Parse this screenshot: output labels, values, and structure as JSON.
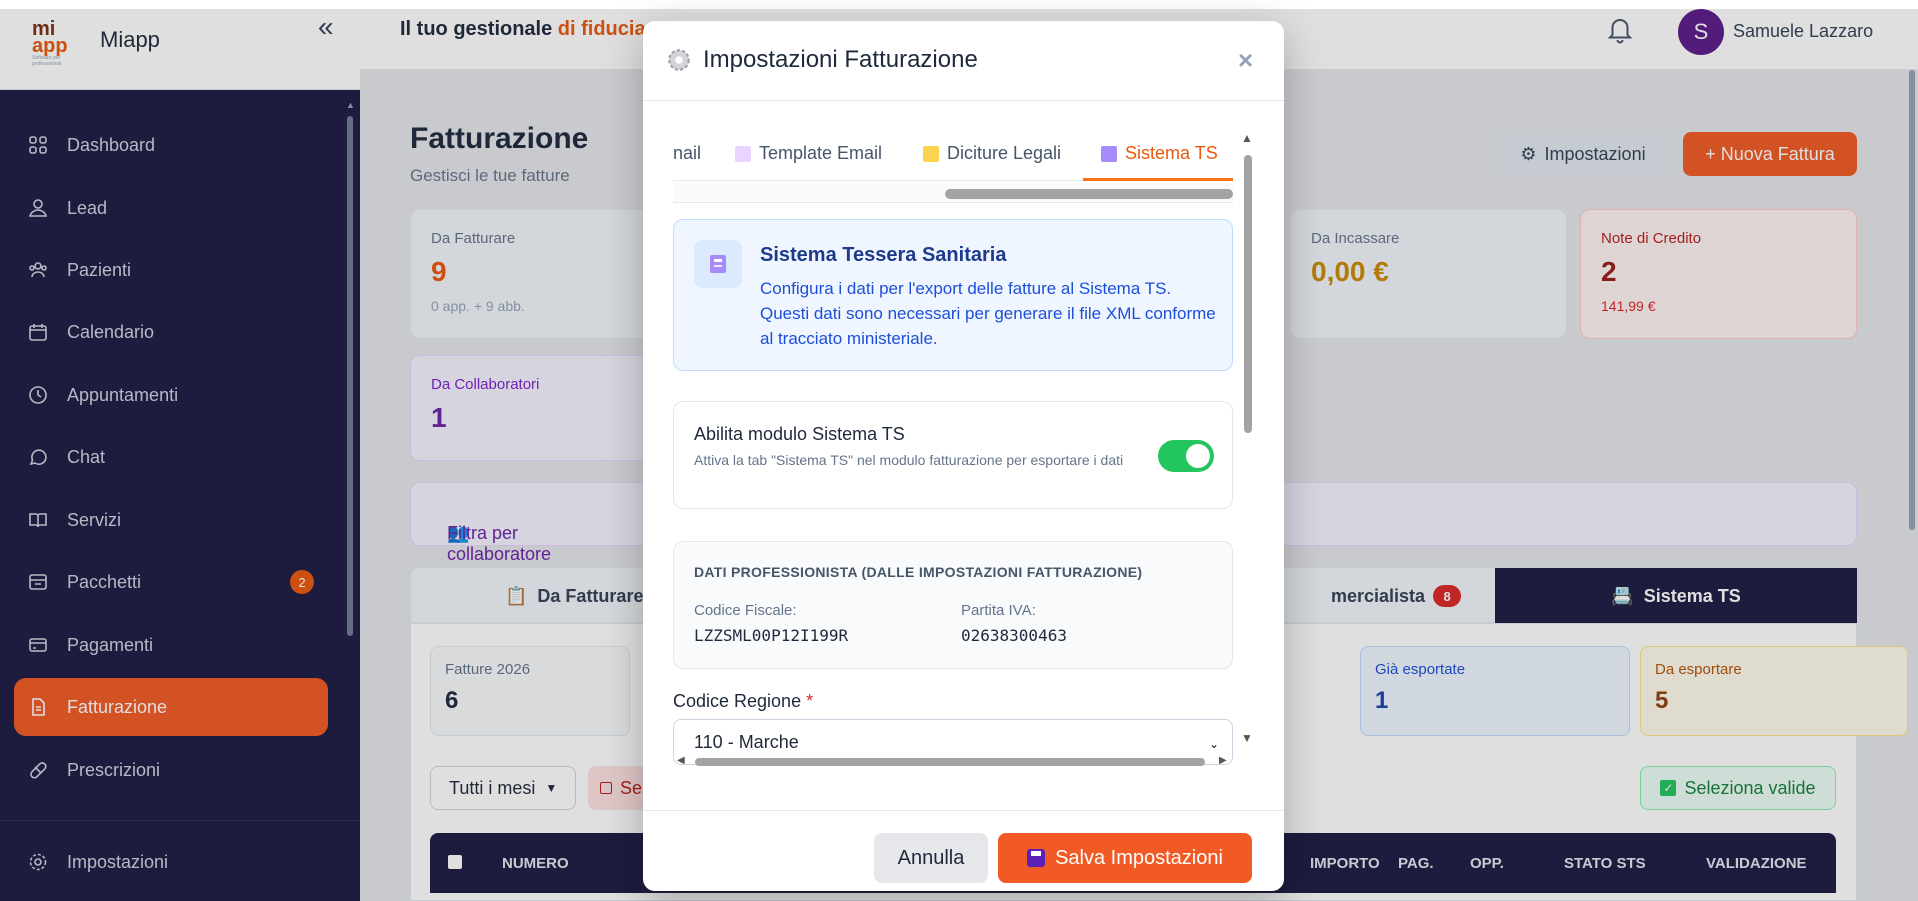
{
  "app": {
    "brand": "Miapp",
    "logo_line1": "mi",
    "logo_line2": "app",
    "logo_tag": "Software per professionisti",
    "tagline_prefix": "Il tuo gestionale ",
    "tagline_accent": "di fiducia"
  },
  "user": {
    "initial": "S",
    "name": "Samuele Lazzaro"
  },
  "sidebar": {
    "items": [
      {
        "label": "Dashboard",
        "icon": "grid-icon"
      },
      {
        "label": "Lead",
        "icon": "user-icon"
      },
      {
        "label": "Pazienti",
        "icon": "users-icon"
      },
      {
        "label": "Calendario",
        "icon": "calendar-icon"
      },
      {
        "label": "Appuntamenti",
        "icon": "clock-icon"
      },
      {
        "label": "Chat",
        "icon": "chat-icon"
      },
      {
        "label": "Servizi",
        "icon": "book-icon"
      },
      {
        "label": "Pacchetti",
        "icon": "package-icon",
        "badge": "2"
      },
      {
        "label": "Pagamenti",
        "icon": "credit-card-icon"
      },
      {
        "label": "Fatturazione",
        "icon": "file-icon",
        "active": true
      },
      {
        "label": "Prescrizioni",
        "icon": "pill-icon"
      }
    ],
    "settings_label": "Impostazioni"
  },
  "page": {
    "title": "Fatturazione",
    "subtitle": "Gestisci le tue fatture",
    "settings_button": "Impostazioni",
    "new_button": "+ Nuova Fattura"
  },
  "cards": {
    "da_fatturare": {
      "label": "Da Fatturare",
      "value": "9",
      "sub": "0 app. + 9 abb."
    },
    "da_incassare": {
      "label": "Da Incassare",
      "value": "0,00 €"
    },
    "note_credito": {
      "label": "Note di Credito",
      "value": "2",
      "sub": "141,99 €"
    },
    "collaboratori": {
      "label": "Da Collaboratori",
      "value": "1"
    }
  },
  "filter_label": "Filtra per collaboratore",
  "tabs": {
    "da_fatturare": "Da Fatturare",
    "commercialista": "mercialista",
    "commercialista_badge": "8",
    "sistema_ts": "Sistema TS"
  },
  "stats": {
    "fatture": {
      "label": "Fatture 2026",
      "value": "6"
    },
    "esportate": {
      "label": "Già esportate",
      "value": "1"
    },
    "da_esportare": {
      "label": "Da esportare",
      "value": "5"
    }
  },
  "filters": {
    "month": "Tutti i mesi",
    "select_partial": "Se",
    "select_valid": "Seleziona valide"
  },
  "table_headers": {
    "numero": "NUMERO",
    "importo": "IMPORTO",
    "pag": "PAG.",
    "opp": "OPP.",
    "stato": "STATO STS",
    "validazione": "VALIDAZIONE"
  },
  "modal": {
    "title": "Impostazioni Fatturazione",
    "tabs": [
      {
        "label": "nail"
      },
      {
        "label": "Template Email"
      },
      {
        "label": "Diciture Legali"
      },
      {
        "label": "Sistema TS",
        "active": true
      }
    ],
    "info_title": "Sistema Tessera Sanitaria",
    "info_desc": "Configura i dati per l'export delle fatture al Sistema TS. Questi dati sono necessari per generare il file XML conforme al tracciato ministeriale.",
    "toggle_title": "Abilita modulo Sistema TS",
    "toggle_desc": "Attiva la tab \"Sistema TS\" nel modulo fatturazione per esportare i dati",
    "toggle_on": true,
    "prof_header": "DATI PROFESSIONISTA (DALLE IMPOSTAZIONI FATTURAZIONE)",
    "cf_label": "Codice Fiscale:",
    "cf_value": "LZZSML00P12I199R",
    "piva_label": "Partita IVA:",
    "piva_value": "02638300463",
    "region_label": "Codice Regione",
    "region_required": "*",
    "region_value": "110 - Marche",
    "cancel": "Annulla",
    "save": "Salva Impostazioni"
  },
  "colors": {
    "accent": "#f15a24",
    "sidebar": "#1c1a42",
    "success": "#22c55e",
    "info": "#1d4ed8"
  }
}
